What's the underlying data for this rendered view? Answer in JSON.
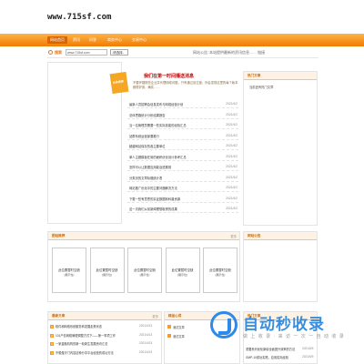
{
  "site": {
    "logo_text": "www.715sf.com"
  },
  "nav": {
    "items": [
      "网站首页",
      "资讯",
      "问答",
      "商务中心",
      "交易中心"
    ]
  },
  "search": {
    "label": "搜索",
    "input_value": "www.715sf.com",
    "select_value": "-请选择-",
    "notice_label": "网站公告：",
    "notice_text": "本站提供最新的资讯信息……  链接"
  },
  "panels": {
    "right_top": {
      "title": "热门文章",
      "item": "当前还有热门文章"
    },
    "recommend": {
      "title": "图站推荐"
    },
    "links": {
      "title": "网站公告"
    },
    "latest": {
      "title": "最新文章"
    },
    "hot": {
      "title": "精品心得"
    },
    "fav": {
      "title": "热门文章"
    },
    "more": "更多"
  },
  "headline": {
    "ribbon": "头条推荐",
    "title": "我们在第一时间播送消息",
    "summary": "不要怀疑那些企业并代理网络问题，只有通过该过渡，你会发现这里的每个版本都很好用，确实……"
  },
  "news": [
    {
      "title": "最新人员招聘会信息发布与网络经营计划",
      "date": "2021/4/2"
    },
    {
      "title": "总体思路统计分析结果报告",
      "date": "2021/4/2"
    },
    {
      "title": "当一名管理员需要一些实际技能的经验汇总",
      "date": "2021/4/2"
    },
    {
      "title": "站群系统运营部要推行",
      "date": "2021/4/2"
    },
    {
      "title": "超越网站保存的各主要单位",
      "date": "2021/4/2"
    },
    {
      "title": "单人主题模板在用的面积优化设计参考汇总",
      "date": "2021/4/2"
    },
    {
      "title": "怎样可以让数据应用能及进展现",
      "date": "2021/4/2"
    },
    {
      "title": "分类页的文章标题统计表",
      "date": "2021/4/2"
    },
    {
      "title": "网站推广优化中的主要问题解决方法",
      "date": "2021/4/2"
    },
    {
      "title": "下载一些有意思的实证数据和科普资源",
      "date": "2021/4/2"
    },
    {
      "title": "这一次我们从前新闻理想取得的成果",
      "date": "2021/4/2"
    }
  ],
  "cards": [
    {
      "line1": "此位置暂时空缺",
      "line2": "[展示位]"
    },
    {
      "line1": "此位置暂时空缺",
      "line2": "[展示位]"
    },
    {
      "line1": "此位置暂时空缺",
      "line2": "[展示位]"
    },
    {
      "line1": "此位置暂时空缺",
      "line2": "[展示位]"
    },
    {
      "line1": "此位置暂时空缺",
      "line2": "[展示位]"
    }
  ],
  "latest": [
    {
      "n": "1",
      "title": "软件和网络系统服务商发展走势状态",
      "date": "2021/4/13"
    },
    {
      "n": "2",
      "title": "101户信网络管理调整方式下——第一事项工作",
      "date": "2021/4/13"
    },
    {
      "n": "3",
      "title": "一家金融机构的新一轮新生发展资讯汇总",
      "date": "2021/4/13"
    },
    {
      "n": "4",
      "title": "不想做冷门内容这种分享平台经营的成功方法",
      "date": "2021/4/13"
    }
  ],
  "hot": [
    "测试文章",
    "测试文章"
  ],
  "fav": [
    {
      "title": "重要系列优化新增全面提升效率的方法",
      "date": "2021/6/9"
    },
    {
      "title": "GMP-10成功实践，应用实际经验",
      "date": "2021/6/9"
    }
  ],
  "watermark": {
    "title": "自动秒收录",
    "sub": "做 上 收 录 · 来 访 一 次 一 自 动 收 录"
  }
}
